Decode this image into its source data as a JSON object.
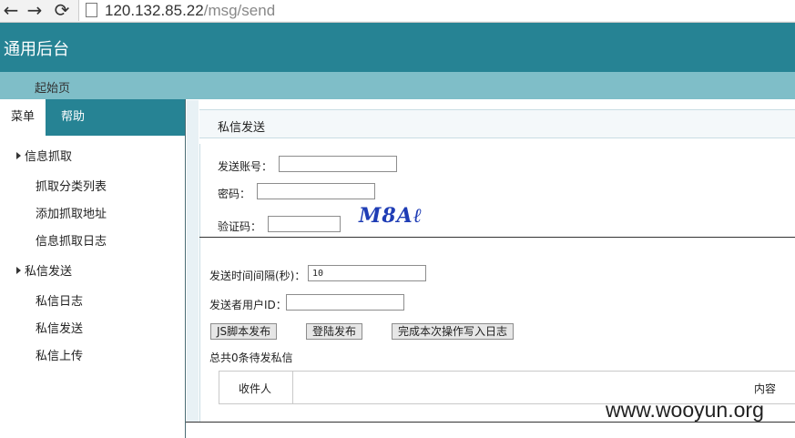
{
  "browser": {
    "url_host": "120.132.85.22",
    "url_path": "/msg/send",
    "back_icon": "←",
    "forward_icon": "→",
    "reload_icon": "⟳"
  },
  "header": {
    "title": "通用后台"
  },
  "subnav": {
    "home": "起始页"
  },
  "sidebar": {
    "tabs": [
      {
        "label": "菜单"
      },
      {
        "label": "帮助"
      }
    ],
    "groups": [
      {
        "label": "信息抓取",
        "items": [
          "抓取分类列表",
          "添加抓取地址",
          "信息抓取日志"
        ]
      },
      {
        "label": "私信发送",
        "items": [
          "私信日志",
          "私信发送",
          "私信上传"
        ]
      }
    ]
  },
  "panel": {
    "title": "私信发送",
    "account_label": "发送账号：",
    "password_label": "密码：",
    "captcha_label": "验证码：",
    "captcha_text": "M8Aℓ",
    "interval_label": "发送时间间隔(秒)：",
    "interval_value": "10",
    "sender_id_label": "发送者用户ID：",
    "buttons": {
      "js": "JS脚本发布",
      "login": "登陆发布",
      "log": "完成本次操作写入日志"
    },
    "summary": "总共0条待发私信",
    "table": {
      "headers": [
        "收件人",
        "内容"
      ]
    }
  },
  "watermark": "www.wooyun.org",
  "colors": {
    "header": "#268394",
    "subnav": "#7fbec8"
  }
}
